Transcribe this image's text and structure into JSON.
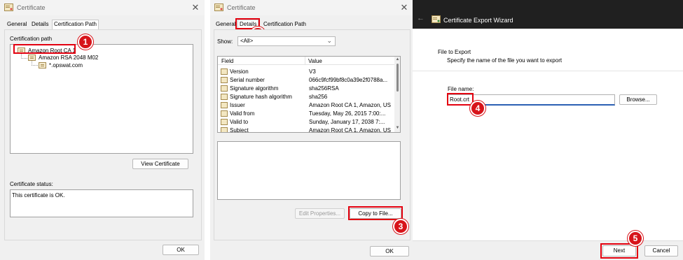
{
  "panel1": {
    "title": "Certificate",
    "tabs": [
      "General",
      "Details",
      "Certification Path"
    ],
    "path_label": "Certification path",
    "tree": [
      "Amazon Root CA 1",
      "Amazon RSA 2048 M02",
      "*.opswat.com"
    ],
    "view_button": "View Certificate",
    "status_label": "Certificate status:",
    "status_text": "This certificate is OK.",
    "ok": "OK"
  },
  "panel2": {
    "title": "Certificate",
    "tabs": [
      "General",
      "Details",
      "Certification Path"
    ],
    "show_label": "Show:",
    "show_value": "<All>",
    "col_field": "Field",
    "col_value": "Value",
    "rows": [
      {
        "field": "Version",
        "value": "V3"
      },
      {
        "field": "Serial number",
        "value": "066c9fcf99bf8c0a39e2f0788a..."
      },
      {
        "field": "Signature algorithm",
        "value": "sha256RSA"
      },
      {
        "field": "Signature hash algorithm",
        "value": "sha256"
      },
      {
        "field": "Issuer",
        "value": "Amazon Root CA 1, Amazon, US"
      },
      {
        "field": "Valid from",
        "value": "Tuesday, May 26, 2015 7:00:..."
      },
      {
        "field": "Valid to",
        "value": "Sunday, January 17, 2038 7:..."
      },
      {
        "field": "Subject",
        "value": "Amazon Root CA 1, Amazon, US"
      }
    ],
    "edit_button": "Edit Properties...",
    "copy_button": "Copy to File...",
    "ok": "OK"
  },
  "panel3": {
    "title": "Certificate Export Wizard",
    "section_title": "File to Export",
    "section_desc": "Specify the name of the file you want to export",
    "file_label": "File name:",
    "file_value": "Root.crt",
    "browse": "Browse...",
    "next": "Next",
    "cancel": "Cancel"
  },
  "badges": [
    "1",
    "2",
    "3",
    "4",
    "5"
  ],
  "colors": {
    "highlight": "#e3000f",
    "badge": "#d7141a",
    "wizard_header": "#202020"
  }
}
